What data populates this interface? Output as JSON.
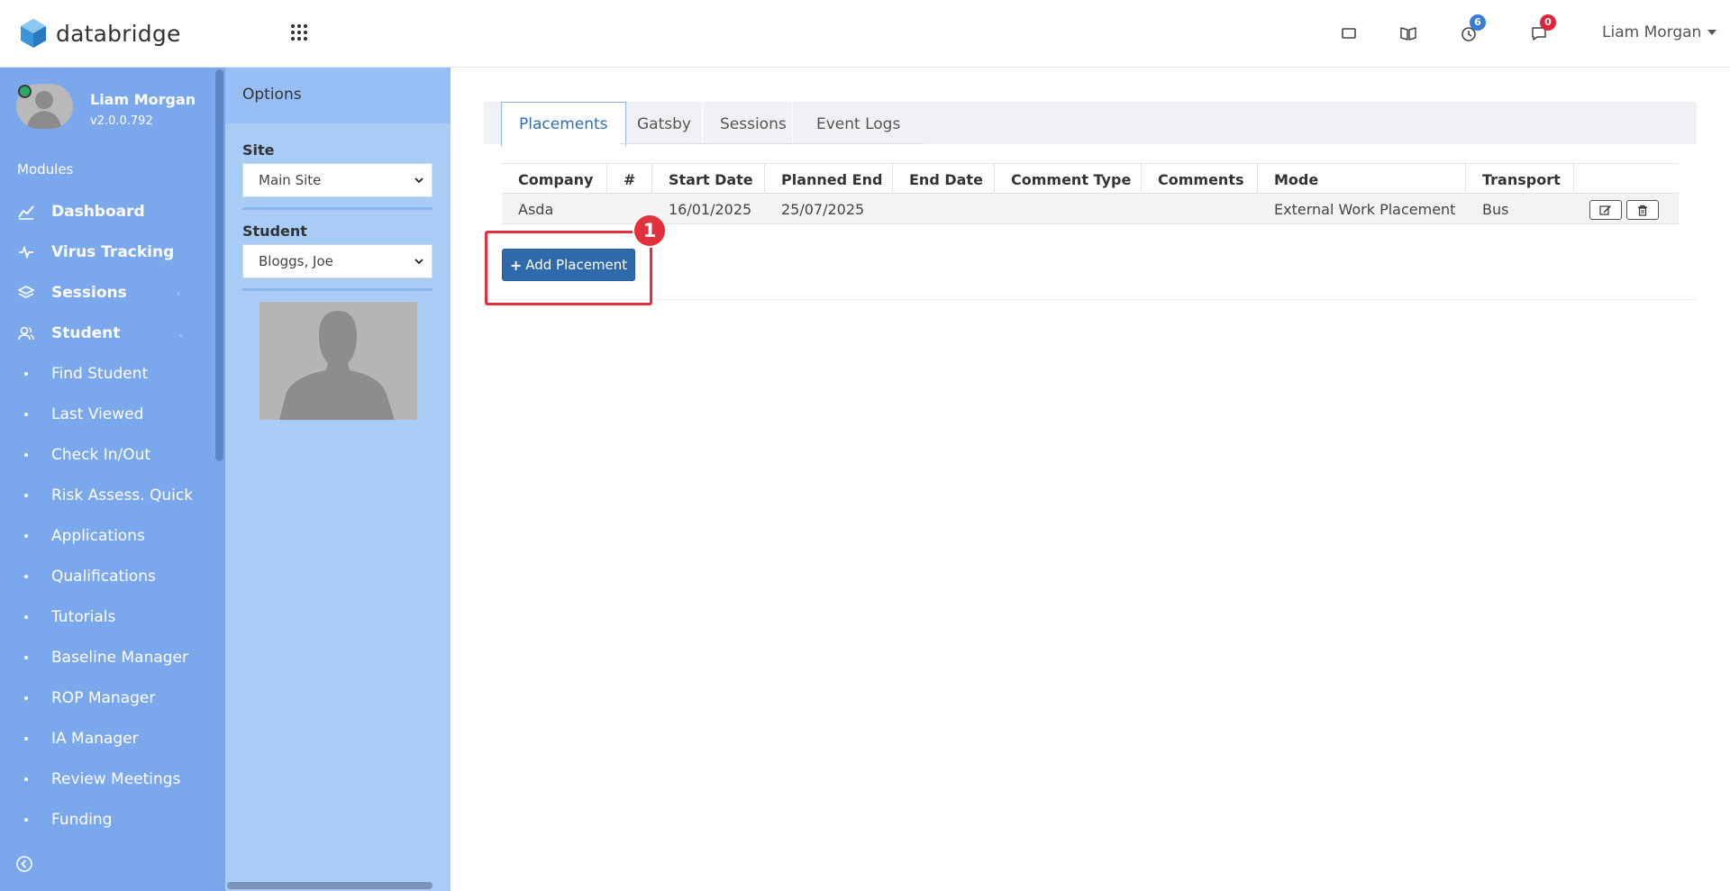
{
  "header": {
    "brand": "databridge",
    "user_name": "Liam Morgan",
    "notifications": {
      "timer_count": "6",
      "messages_count": "0"
    }
  },
  "sidebar": {
    "profile": {
      "name": "Liam Morgan",
      "version": "v2.0.0.792"
    },
    "modules_label": "Modules",
    "items": [
      {
        "label": "Dashboard",
        "icon": "chart-line-icon",
        "bold": true
      },
      {
        "label": "Virus Tracking",
        "icon": "heartbeat-icon",
        "bold": true
      },
      {
        "label": "Sessions",
        "icon": "layers-icon",
        "bold": true,
        "chevron": "‹"
      },
      {
        "label": "Student",
        "icon": "users-icon",
        "bold": true,
        "chevron": "⌄"
      },
      {
        "label": "Find Student"
      },
      {
        "label": "Last Viewed"
      },
      {
        "label": "Check In/Out"
      },
      {
        "label": "Risk Assess. Quick"
      },
      {
        "label": "Applications"
      },
      {
        "label": "Qualifications"
      },
      {
        "label": "Tutorials"
      },
      {
        "label": "Baseline Manager"
      },
      {
        "label": "ROP Manager"
      },
      {
        "label": "IA Manager"
      },
      {
        "label": "Review Meetings"
      },
      {
        "label": "Funding"
      }
    ]
  },
  "options": {
    "title": "Options",
    "site_label": "Site",
    "site_value": "Main Site",
    "student_label": "Student",
    "student_value": "Bloggs, Joe"
  },
  "main": {
    "tabs": [
      "Placements",
      "Gatsby",
      "Sessions",
      "Event Logs"
    ],
    "active_tab": "Placements",
    "table": {
      "columns": [
        "Company",
        "#",
        "Start Date",
        "Planned End",
        "End Date",
        "Comment Type",
        "Comments",
        "Mode",
        "Transport",
        ""
      ],
      "rows": [
        [
          "Asda",
          "",
          "16/01/2025",
          "25/07/2025",
          "",
          "",
          "",
          "External Work Placement",
          "Bus"
        ]
      ]
    },
    "add_button_label": "Add Placement",
    "annotation_step": "1"
  },
  "colors": {
    "sidebar_bg": "#7ba7ec",
    "options_bg": "#a9ccf7",
    "primary_button": "#2f6aad",
    "highlight": "#e2303c"
  }
}
